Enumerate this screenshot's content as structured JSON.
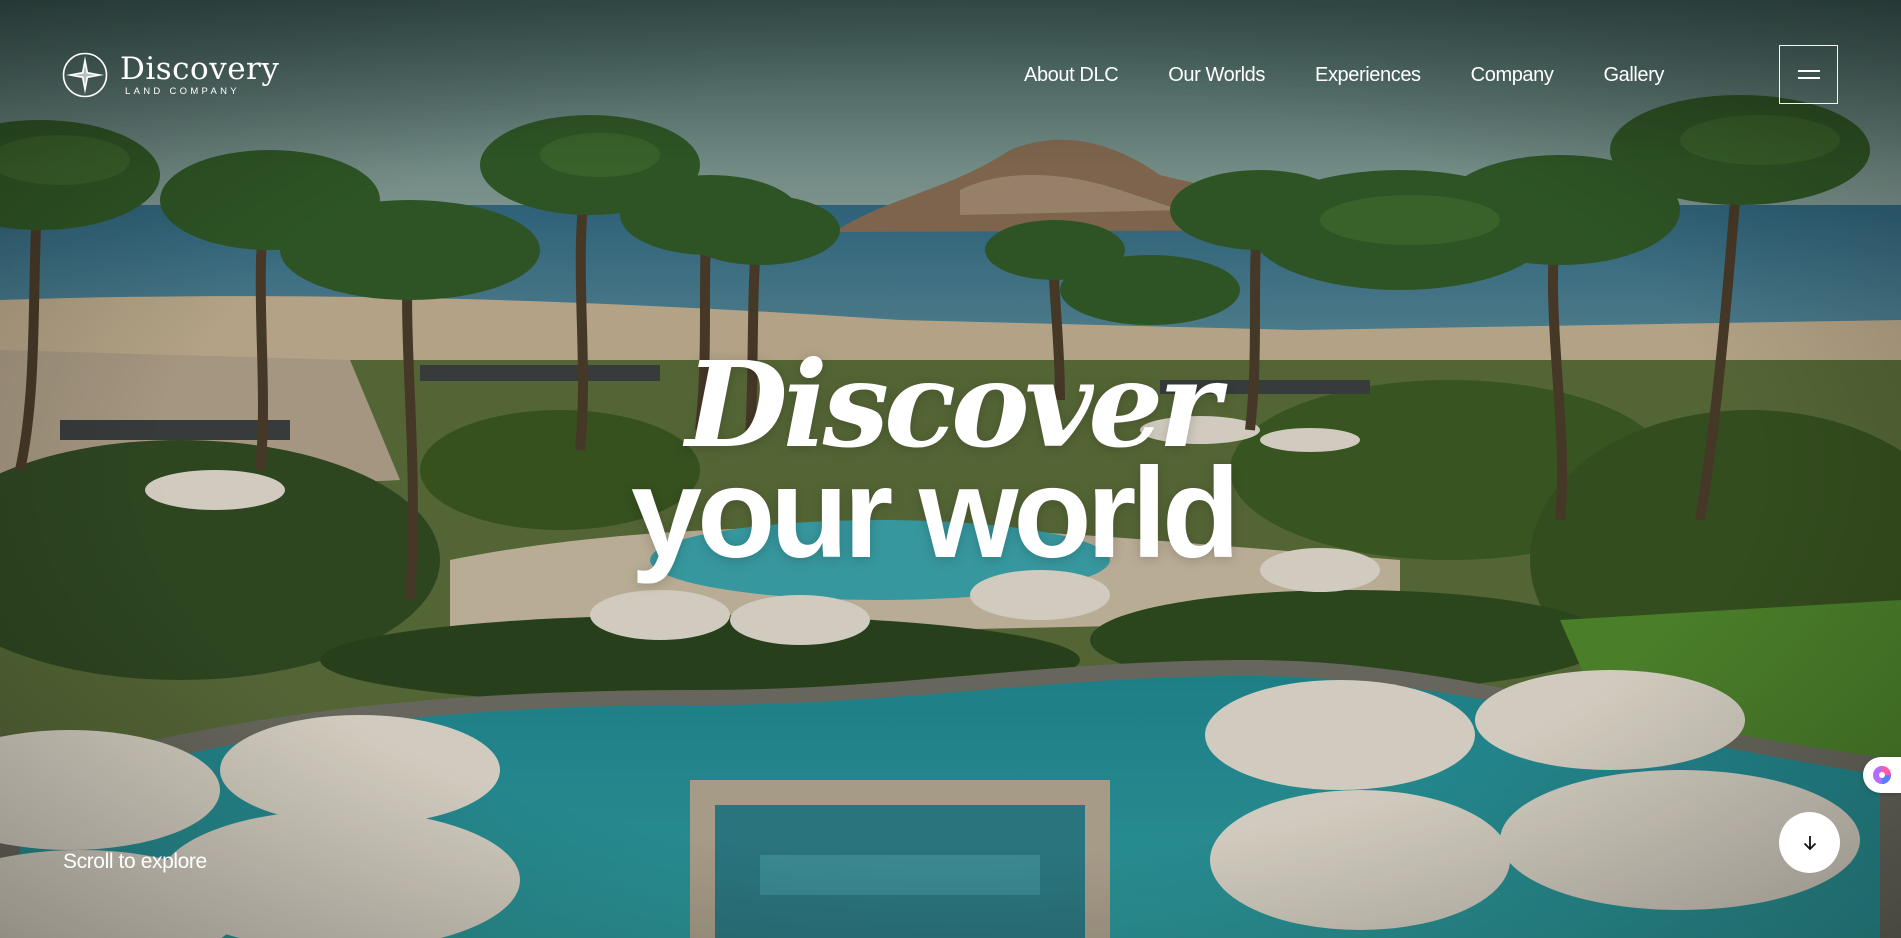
{
  "brand": {
    "name": "Discovery",
    "tagline": "LAND COMPANY"
  },
  "nav": {
    "items": [
      {
        "label": "About DLC"
      },
      {
        "label": "Our Worlds"
      },
      {
        "label": "Experiences"
      },
      {
        "label": "Company"
      },
      {
        "label": "Gallery"
      }
    ]
  },
  "hero": {
    "headline_script": "Discover",
    "headline_main": "your world",
    "scroll_label": "Scroll to explore",
    "background": "aerial view of resort with palm trees, infinity pools, white umbrellas and ocean bay"
  },
  "icons": {
    "logo": "compass-star-icon",
    "menu": "hamburger-icon",
    "scroll": "arrow-down-icon",
    "badge": "color-wheel-icon"
  },
  "colors": {
    "text": "#ffffff",
    "button_bg": "#ffffff",
    "button_icon": "#111111"
  }
}
